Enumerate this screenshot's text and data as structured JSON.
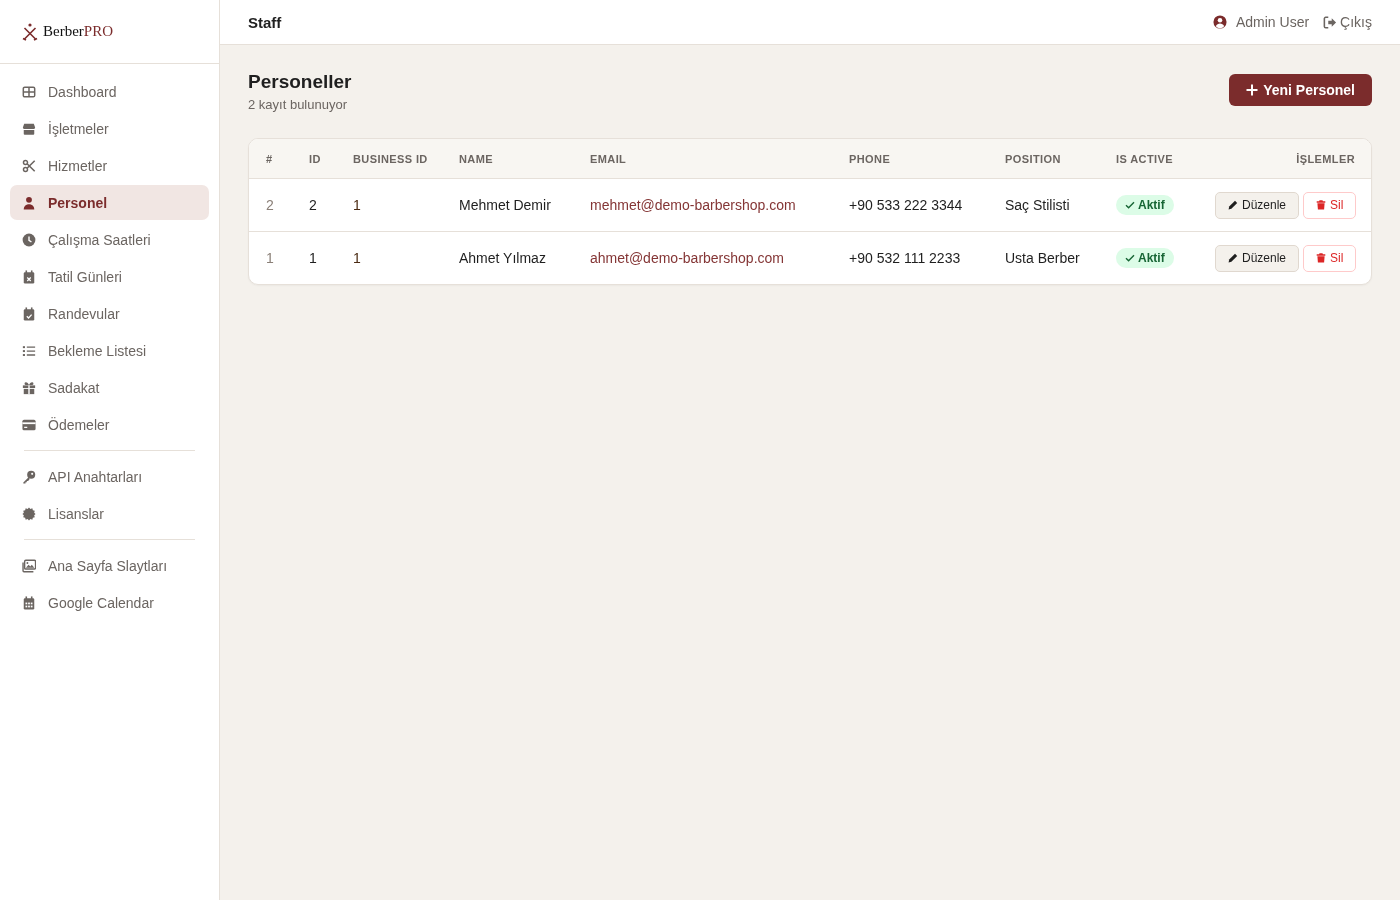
{
  "brand": {
    "name": "Berber",
    "suffix": "PRO"
  },
  "sidebar": {
    "sections": [
      {
        "items": [
          {
            "label": "Dashboard",
            "selected": false
          },
          {
            "label": "İşletmeler",
            "selected": false
          },
          {
            "label": "Hizmetler",
            "selected": false
          },
          {
            "label": "Personel",
            "selected": true
          },
          {
            "label": "Çalışma Saatleri",
            "selected": false
          },
          {
            "label": "Tatil Günleri",
            "selected": false
          },
          {
            "label": "Randevular",
            "selected": false
          },
          {
            "label": "Bekleme Listesi",
            "selected": false
          },
          {
            "label": "Sadakat",
            "selected": false
          },
          {
            "label": "Ödemeler",
            "selected": false
          }
        ]
      },
      {
        "items": [
          {
            "label": "API Anahtarları",
            "selected": false
          },
          {
            "label": "Lisanslar",
            "selected": false
          }
        ]
      },
      {
        "items": [
          {
            "label": "Ana Sayfa Slaytları",
            "selected": false
          },
          {
            "label": "Google Calendar",
            "selected": false
          }
        ]
      }
    ]
  },
  "top_bar": {
    "title": "Staff",
    "user": "Admin User",
    "logout": "Çıkış"
  },
  "page": {
    "title": "Personeller",
    "subtitle": "2 kayıt bulunuyor",
    "new_button": "Yeni Personel"
  },
  "table": {
    "columns": [
      "#",
      "ID",
      "BUSINESS ID",
      "NAME",
      "EMAIL",
      "PHONE",
      "POSITION",
      "IS ACTIVE",
      "İŞLEMLER"
    ],
    "rows": [
      {
        "number": "2",
        "id": "2",
        "business_id": "1",
        "name": "Mehmet Demir",
        "email": "mehmet@demo-barbershop.com",
        "phone": "+90 533 222 3344",
        "position": "Saç Stilisti",
        "active": true,
        "status": "Aktif",
        "edit": "Düzenle",
        "delete": "Sil"
      },
      {
        "number": "1",
        "id": "1",
        "business_id": "1",
        "name": "Ahmet Yılmaz",
        "email": "ahmet@demo-barbershop.com",
        "phone": "+90 532 111 2233",
        "position": "Usta Berber",
        "active": true,
        "status": "Aktif",
        "edit": "Düzenle",
        "delete": "Sil"
      }
    ]
  }
}
